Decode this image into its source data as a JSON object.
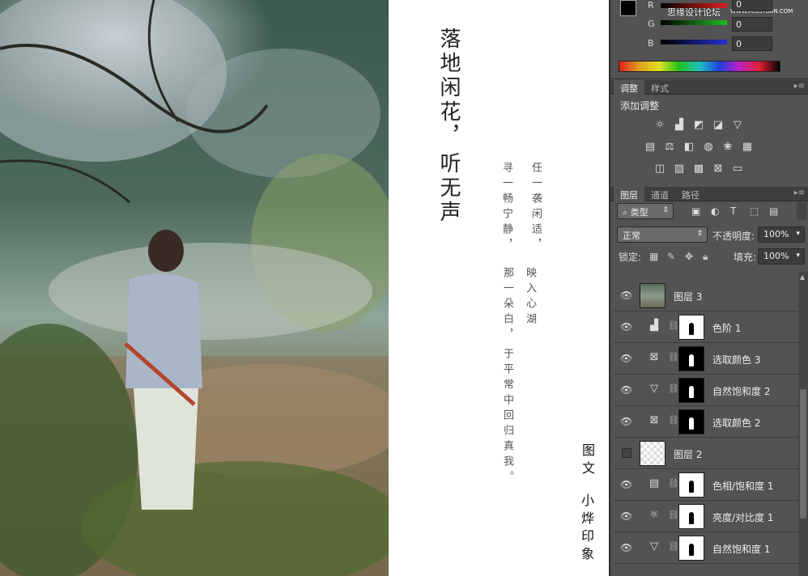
{
  "color_panel": {
    "channels": [
      {
        "label": "R",
        "value": "0",
        "color": "#e02020"
      },
      {
        "label": "G",
        "value": "0",
        "color": "#20c020"
      },
      {
        "label": "B",
        "value": "0",
        "color": "#2030d0"
      }
    ],
    "watermark": "思缘设计论坛",
    "watermark_url": "WWW.MISSYUAN.COM"
  },
  "adjust_panel": {
    "tabs": [
      "调整",
      "样式"
    ],
    "title": "添加调整"
  },
  "layers_panel": {
    "tabs": [
      "图层",
      "通道",
      "路径"
    ],
    "filter_label": "类型",
    "blend_mode": "正常",
    "opacity_label": "不透明度:",
    "opacity_value": "100%",
    "lock_label": "锁定:",
    "fill_label": "填充:",
    "fill_value": "100%",
    "layers": [
      {
        "name": "图层 3",
        "kind": "pixel",
        "thumb": "photo",
        "visible": true
      },
      {
        "name": "色阶 1",
        "kind": "adjust",
        "glyph": "levels-icon",
        "mask": "white",
        "visible": true
      },
      {
        "name": "选取颜色 3",
        "kind": "adjust",
        "glyph": "selective-color-icon",
        "mask": "black",
        "visible": true
      },
      {
        "name": "自然饱和度 2",
        "kind": "adjust",
        "glyph": "vibrance-icon",
        "mask": "black",
        "visible": true
      },
      {
        "name": "选取颜色 2",
        "kind": "adjust",
        "glyph": "selective-color-icon",
        "mask": "black",
        "visible": true
      },
      {
        "name": "图层 2",
        "kind": "pixel",
        "thumb": "transparent",
        "visible": false
      },
      {
        "name": "色相/饱和度 1",
        "kind": "adjust",
        "glyph": "hue-saturation-icon",
        "mask": "white",
        "visible": true
      },
      {
        "name": "亮度/对比度 1",
        "kind": "adjust",
        "glyph": "brightness-icon",
        "mask": "white",
        "visible": true
      },
      {
        "name": "自然饱和度 1",
        "kind": "adjust",
        "glyph": "vibrance-icon",
        "mask": "white",
        "visible": true
      }
    ]
  },
  "canvas": {
    "title_line1": "落地闲花，",
    "title_line2": "听无声",
    "poem": [
      "任一袭闲适，",
      "寻一畅宁静，",
      "映入心湖",
      "那一朵白，",
      "于平常中回归真我。"
    ],
    "signature_line1": "图文",
    "signature_line2": "小烨印象"
  }
}
